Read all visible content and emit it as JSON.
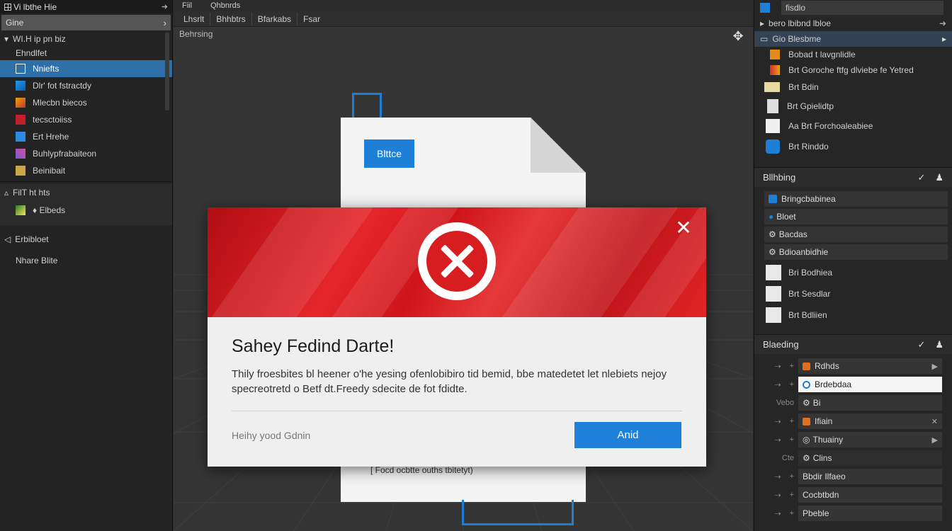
{
  "left_panel": {
    "title": "Vi lbthe Hie",
    "pin_icon": "pin-icon",
    "search_value": "Gine",
    "tree_header": "WI.H ip pn biz",
    "tree_items": [
      {
        "label": "Ehndlfet",
        "icon": "none"
      },
      {
        "label": "Nniefts",
        "icon": "doc-icon",
        "selected": true
      },
      {
        "label": "Dlr' fot fstractdy",
        "icon": "windows-icon"
      },
      {
        "label": "Mlecbn biecos",
        "icon": "folder-icon"
      },
      {
        "label": "tecsctoiiss",
        "icon": "red-icon"
      },
      {
        "label": "Ert Hrehe",
        "icon": "blue-icon"
      },
      {
        "label": "Buhlypfrabaiteon",
        "icon": "x-icon"
      },
      {
        "label": "Beinibait",
        "icon": "gear-icon"
      }
    ],
    "group_header": "FilT ht hts",
    "group_item": "♦ Elbeds",
    "section_1": "Erbibloet",
    "section_2": "Nhare  Blite"
  },
  "viewport": {
    "menu": [
      "Fiil",
      "Qhbnrds"
    ],
    "tabs": [
      "Lhsrlt",
      "Bhhbtrs",
      "Bfarkabs",
      "Fsar"
    ],
    "label": "Behrsing",
    "move_icon": "move-icon",
    "paper_tag": "Blttce",
    "paper_footer": "[  Focd ocbtte ouths tbitetyt)"
  },
  "dialog": {
    "title": "Sahey Fedind Darte!",
    "body": "Thily froesbites bl heener o'he yesing ofenlobibiro tid bemid, bbe matedetet let nlebiets nejoy specreotretd o Betf dt.Freedy sdecite de fot fdidte.",
    "footnote": "Heihy yood Gdnin",
    "button": "Anid",
    "close_icon": "close-icon",
    "error_icon": "error-x-icon",
    "header_color": "#d81d21",
    "accent_color": "#1e80d8"
  },
  "right_panel": {
    "top_field": "fisdlo",
    "rows": [
      {
        "label": "bero lbibnd lbloe"
      },
      {
        "label": "Gio Blesbme",
        "selected": true
      }
    ],
    "list": [
      {
        "label": "Bobad t lavgnlidle"
      },
      {
        "label": "Brt Goroche  ftfg dlviebe  fe Yetred"
      },
      {
        "label": "Brt  Bdin"
      },
      {
        "label": "Brt  Gpielidtp"
      },
      {
        "label": "Aa  Brt Forchoaleabiee"
      },
      {
        "label": "Brt  Rinddo"
      }
    ],
    "section_a": "Bllhbing",
    "fields_a": [
      "Bringcbabinea",
      "Bloet",
      "Bacdas",
      "Bdioanbidhie"
    ],
    "items_a": [
      "Bri  Bodhiea",
      "Brt  Sesdlar",
      "Brt  Bdliien"
    ],
    "section_b": "Blaeding",
    "props": [
      {
        "label": "",
        "value": "Rdhds",
        "style": "dark"
      },
      {
        "label": "",
        "value": "Brdebdaa",
        "style": "white"
      },
      {
        "label": "Vebo",
        "value": "Bi",
        "style": "dark"
      },
      {
        "label": "",
        "value": "Ifiain",
        "style": "dark"
      },
      {
        "label": "",
        "value": "Thuainy",
        "style": "dark"
      },
      {
        "label": "Cte",
        "value": "Clins",
        "style": "dark"
      },
      {
        "label": "",
        "value": "Bbdir Ilfaeo",
        "style": "dark"
      },
      {
        "label": "",
        "value": "Cocbtbdn",
        "style": "dark"
      },
      {
        "label": "",
        "value": "Pbeble",
        "style": "dark"
      }
    ]
  }
}
